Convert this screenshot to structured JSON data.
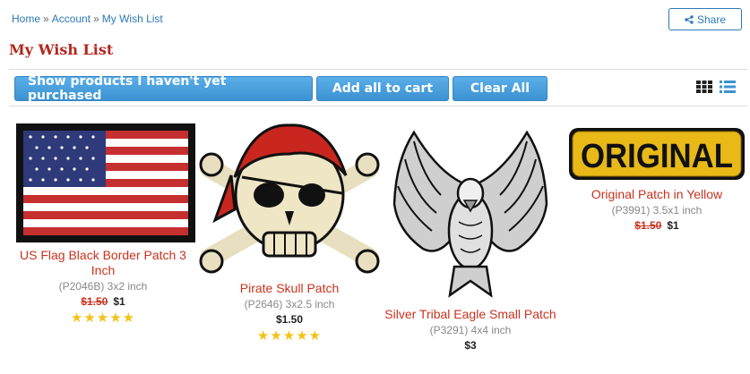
{
  "breadcrumb": {
    "home": "Home",
    "account": "Account",
    "current": "My Wish List",
    "sep": "»"
  },
  "share": {
    "label": "Share"
  },
  "page": {
    "title": "My Wish List"
  },
  "toolbar": {
    "show_unpurchased": "Show products I haven't yet purchased",
    "add_all": "Add all to cart",
    "clear_all": "Clear All"
  },
  "view": {
    "grid": "grid-view-icon",
    "list": "list-view-icon"
  },
  "products": [
    {
      "name": "US Flag Black Border Patch 3 Inch",
      "sku": "(P2046B) 3x2 inch",
      "old_price": "$1.50",
      "price": "$1",
      "stars": "★★★★★"
    },
    {
      "name": "Pirate Skull Patch",
      "sku": "(P2646) 3x2.5 inch",
      "old_price": "",
      "price": "$1.50",
      "stars": "★★★★★"
    },
    {
      "name": "Silver Tribal Eagle Small Patch",
      "sku": "(P3291) 4x4 inch",
      "old_price": "",
      "price": "$3",
      "stars": ""
    },
    {
      "name": "Original Patch in Yellow",
      "sku": "(P3991) 3.5x1 inch",
      "old_price": "$1.50",
      "price": "$1",
      "stars": "",
      "patch_text": "ORIGINAL"
    }
  ],
  "colors": {
    "accent": "#3c92d2",
    "title": "#b3261e",
    "link": "#2a7ab8",
    "product_name": "#c8331f",
    "star": "#f2c218"
  }
}
